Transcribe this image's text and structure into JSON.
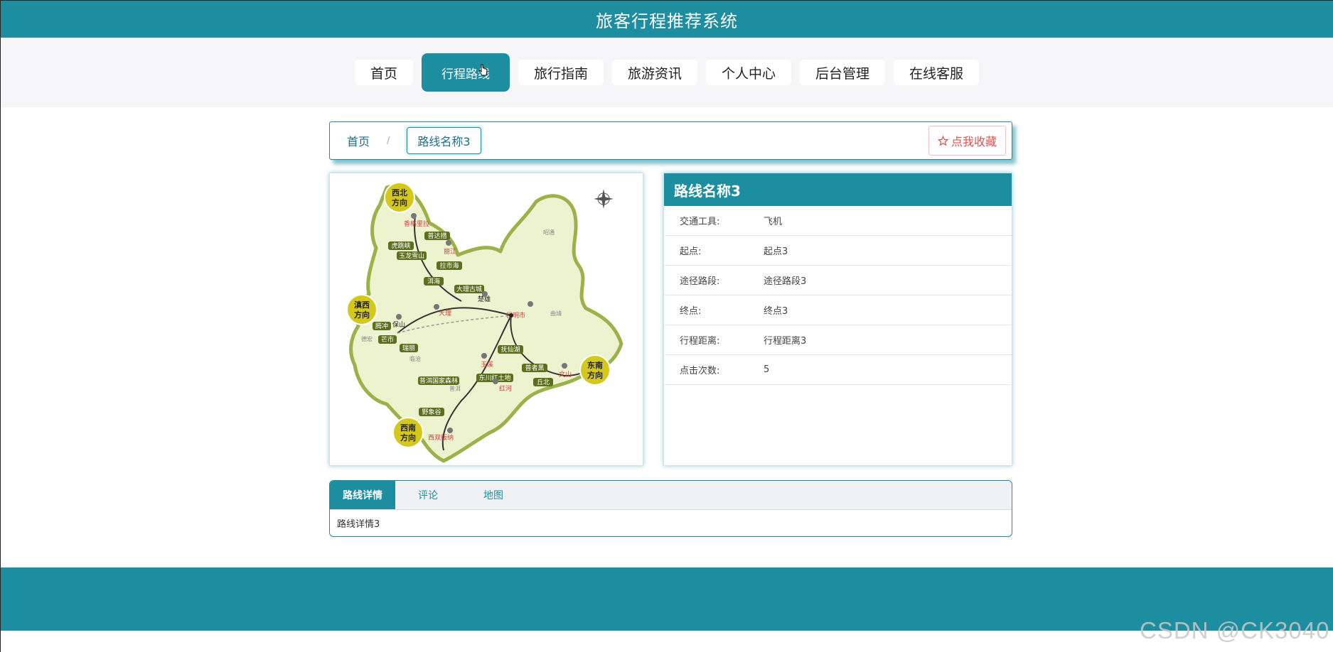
{
  "app": {
    "title": "旅客行程推荐系统"
  },
  "nav": {
    "items": [
      {
        "label": "首页"
      },
      {
        "label": "行程路线"
      },
      {
        "label": "旅行指南"
      },
      {
        "label": "旅游资讯"
      },
      {
        "label": "个人中心"
      },
      {
        "label": "后台管理"
      },
      {
        "label": "在线客服"
      }
    ],
    "active_index": 1
  },
  "breadcrumb": {
    "home": "首页",
    "separator": "/",
    "current": "路线名称3"
  },
  "favorite": {
    "label": "点我收藏",
    "icon": "star-outline-icon",
    "color": "#e0524f"
  },
  "route": {
    "title": "路线名称3",
    "fields": [
      {
        "label": "交通工具:",
        "value": "飞机"
      },
      {
        "label": "起点:",
        "value": "起点3"
      },
      {
        "label": "途径路段:",
        "value": "途径路段3"
      },
      {
        "label": "终点:",
        "value": "终点3"
      },
      {
        "label": "行程距离:",
        "value": "行程距离3"
      },
      {
        "label": "点击次数:",
        "value": "5"
      }
    ]
  },
  "map": {
    "regions": [
      "西北方向",
      "滇西方向",
      "东南方向",
      "西南方向"
    ],
    "places_red": [
      "香格里拉",
      "丽江",
      "大理",
      "昆明市",
      "玉溪",
      "红河",
      "文山",
      "西双版纳"
    ],
    "places_dark": [
      "保山",
      "楚雄"
    ],
    "labels_boxed": [
      "普达措",
      "虎跳峡",
      "玉龙雪山",
      "拉市海",
      "洱海",
      "大理古城",
      "腾冲",
      "芒市",
      "瑞丽",
      "抚仙湖",
      "普者黑",
      "东川红土地",
      "普洱国家森林",
      "丘北",
      "野象谷"
    ],
    "labels_gray": [
      "昭通",
      "曲靖",
      "德宏",
      "临沧",
      "普洱"
    ]
  },
  "tabs": {
    "items": [
      {
        "label": "路线详情"
      },
      {
        "label": "评论"
      },
      {
        "label": "地图"
      }
    ],
    "active_index": 0,
    "content": "路线详情3"
  },
  "watermark": "CSDN @CK3040",
  "colors": {
    "primary": "#1c8ea0",
    "footer": "#1c8ea0"
  }
}
